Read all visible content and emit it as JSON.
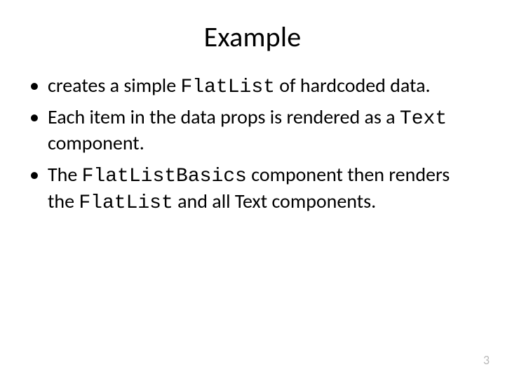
{
  "title": "Example",
  "bullets": [
    {
      "pre": "creates a simple ",
      "code1": "FlatList",
      "mid": " of hardcoded data.",
      "code2": "",
      "post": ""
    },
    {
      "pre": "Each item in the data props is rendered as a ",
      "code1": "Text",
      "mid": " component.",
      "code2": "",
      "post": ""
    },
    {
      "pre": "The ",
      "code1": "FlatListBasics",
      "mid": " component then renders the ",
      "code2": "FlatList",
      "post": " and all Text components."
    }
  ],
  "page_number": "3"
}
